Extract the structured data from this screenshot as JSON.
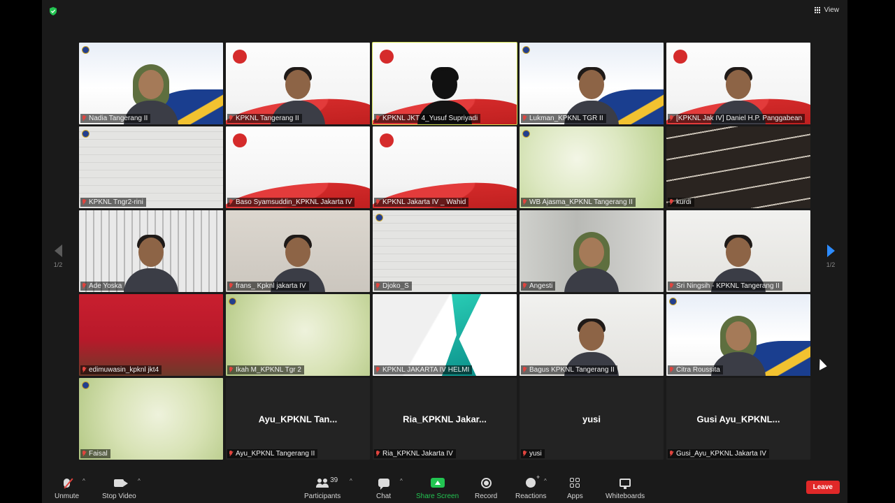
{
  "topbar": {
    "view_label": "View"
  },
  "tiles": [
    {
      "name": "Nadia Tangerang II",
      "bg": "bg-blue",
      "person": "hijab"
    },
    {
      "name": "KPKNL Tangerang II",
      "bg": "bg-asean",
      "person": "normal"
    },
    {
      "name": "KPKNL JKT 4_Yusuf Supriyadi",
      "bg": "bg-asean",
      "person": "silhouette",
      "active": true
    },
    {
      "name": "Lukman_KPKNL TGR II",
      "bg": "bg-blue",
      "person": "normal"
    },
    {
      "name": "[KPKNL Jak IV] Daniel H.P. Panggabean",
      "bg": "bg-asean",
      "person": "normal"
    },
    {
      "name": "KPKNL Tngr2-rini",
      "bg": "bg-brick",
      "person": ""
    },
    {
      "name": "Baso Syamsuddin_KPKNL Jakarta IV",
      "bg": "bg-asean",
      "person": ""
    },
    {
      "name": "KPKNL Jakarta IV _ Wahid",
      "bg": "bg-asean",
      "person": ""
    },
    {
      "name": "WB Ajasma_KPKNL Tangerang II",
      "bg": "bg-green",
      "person": ""
    },
    {
      "name": "kurdi",
      "bg": "bg-stripes",
      "person": ""
    },
    {
      "name": "Ade Yoska",
      "bg": "bg-shelves",
      "person": "normal"
    },
    {
      "name": "frans_ Kpknl jakarta IV",
      "bg": "bg-room2",
      "person": "normal"
    },
    {
      "name": "Djoko_S",
      "bg": "bg-brick",
      "person": ""
    },
    {
      "name": "Angesti",
      "bg": "bg-room",
      "person": "hijab"
    },
    {
      "name": "Sri Ningsih - KPKNL Tangerang II",
      "bg": "bg-wall",
      "person": "normal"
    },
    {
      "name": "edimuwasin_kpknl jkt4",
      "bg": "bg-red",
      "person": ""
    },
    {
      "name": "Ikah M_KPKNL Tgr 2",
      "bg": "bg-green2",
      "person": ""
    },
    {
      "name": "KPKNL JAKARTA IV HELMI",
      "bg": "bg-webinar",
      "person": ""
    },
    {
      "name": "Bagus KPKNL Tangerang II",
      "bg": "bg-wall",
      "person": "normal"
    },
    {
      "name": "Citra Roussita",
      "bg": "bg-blue",
      "person": "hijab"
    },
    {
      "name": "Faisal",
      "bg": "bg-green2",
      "person": ""
    },
    {
      "name": "Ayu_KPKNL Tangerang II",
      "display": "Ayu_KPKNL  Tan...",
      "bg": "blank"
    },
    {
      "name": "Ria_KPKNL Jakarta IV",
      "display": "Ria_KPKNL  Jakar...",
      "bg": "blank"
    },
    {
      "name": "yusi",
      "display": "yusi",
      "bg": "blank"
    },
    {
      "name": "Gusi_Ayu_KPKNL Jakarta IV",
      "display": "Gusi  Ayu_KPKNL...",
      "bg": "blank"
    }
  ],
  "pager": {
    "left": "1/2",
    "right": "1/2"
  },
  "toolbar": {
    "unmute": "Unmute",
    "stop_video": "Stop Video",
    "participants": "Participants",
    "participant_count": "39",
    "chat": "Chat",
    "share_screen": "Share Screen",
    "record": "Record",
    "reactions": "Reactions",
    "apps": "Apps",
    "whiteboards": "Whiteboards",
    "leave": "Leave"
  },
  "colors": {
    "active_speaker": "#d4e256",
    "share": "#23c552",
    "leave": "#e02828",
    "accent": "#2d8cff"
  }
}
